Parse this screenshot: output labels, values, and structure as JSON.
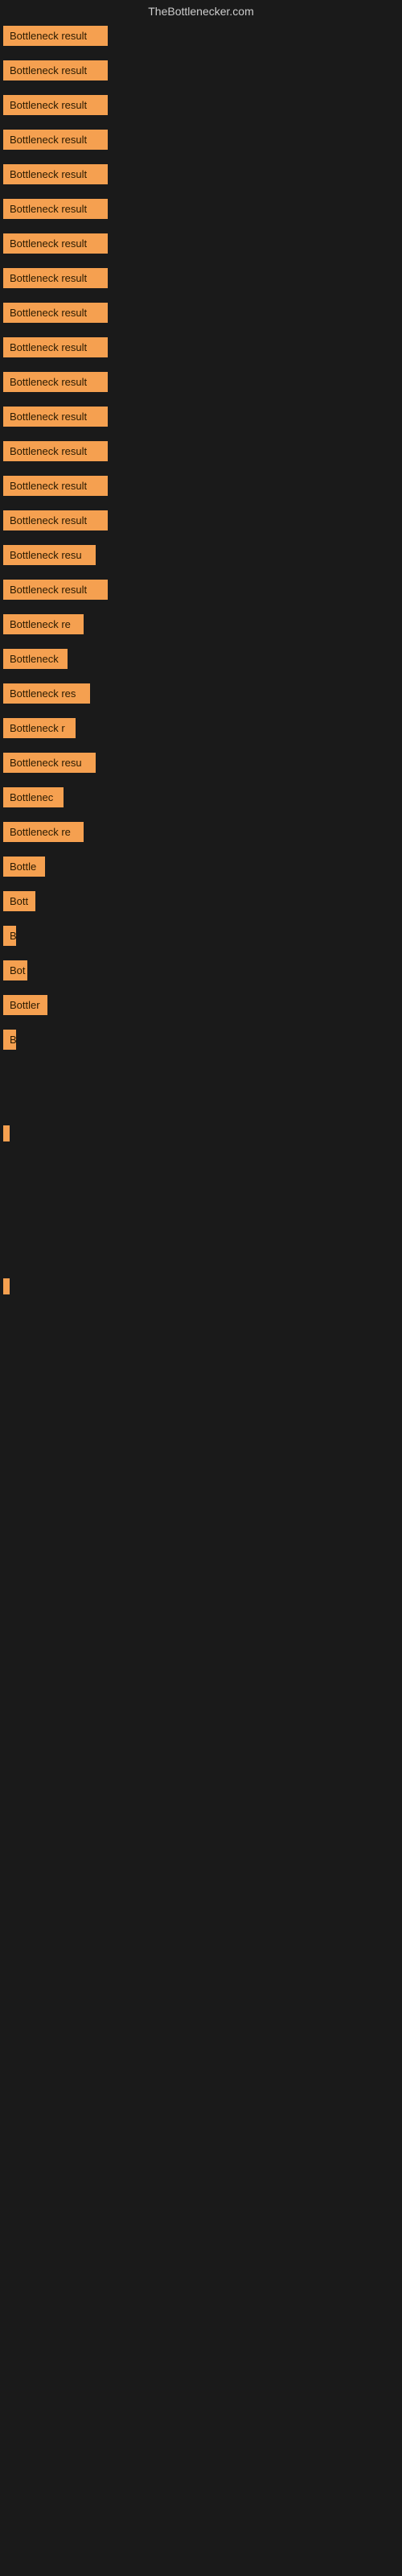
{
  "site": {
    "title": "TheBottlenecker.com"
  },
  "items": [
    {
      "label": "Bottleneck result",
      "width": 130
    },
    {
      "label": "Bottleneck result",
      "width": 130
    },
    {
      "label": "Bottleneck result",
      "width": 130
    },
    {
      "label": "Bottleneck result",
      "width": 130
    },
    {
      "label": "Bottleneck result",
      "width": 130
    },
    {
      "label": "Bottleneck result",
      "width": 130
    },
    {
      "label": "Bottleneck result",
      "width": 130
    },
    {
      "label": "Bottleneck result",
      "width": 130
    },
    {
      "label": "Bottleneck result",
      "width": 130
    },
    {
      "label": "Bottleneck result",
      "width": 130
    },
    {
      "label": "Bottleneck result",
      "width": 130
    },
    {
      "label": "Bottleneck result",
      "width": 130
    },
    {
      "label": "Bottleneck result",
      "width": 130
    },
    {
      "label": "Bottleneck result",
      "width": 130
    },
    {
      "label": "Bottleneck result",
      "width": 130
    },
    {
      "label": "Bottleneck resu",
      "width": 115
    },
    {
      "label": "Bottleneck result",
      "width": 130
    },
    {
      "label": "Bottleneck re",
      "width": 100
    },
    {
      "label": "Bottleneck",
      "width": 80
    },
    {
      "label": "Bottleneck res",
      "width": 108
    },
    {
      "label": "Bottleneck r",
      "width": 90
    },
    {
      "label": "Bottleneck resu",
      "width": 115
    },
    {
      "label": "Bottlenec",
      "width": 75
    },
    {
      "label": "Bottleneck re",
      "width": 100
    },
    {
      "label": "Bottle",
      "width": 52
    },
    {
      "label": "Bott",
      "width": 40
    },
    {
      "label": "B",
      "width": 14
    },
    {
      "label": "Bot",
      "width": 30
    },
    {
      "label": "Bottler",
      "width": 55
    },
    {
      "label": "B",
      "width": 14
    },
    {
      "label": "",
      "width": 0
    },
    {
      "label": "",
      "width": 0
    },
    {
      "label": "|",
      "width": 8
    },
    {
      "label": "",
      "width": 0
    },
    {
      "label": "",
      "width": 0
    },
    {
      "label": "",
      "width": 0
    },
    {
      "label": "",
      "width": 0
    },
    {
      "label": "|",
      "width": 8
    }
  ]
}
